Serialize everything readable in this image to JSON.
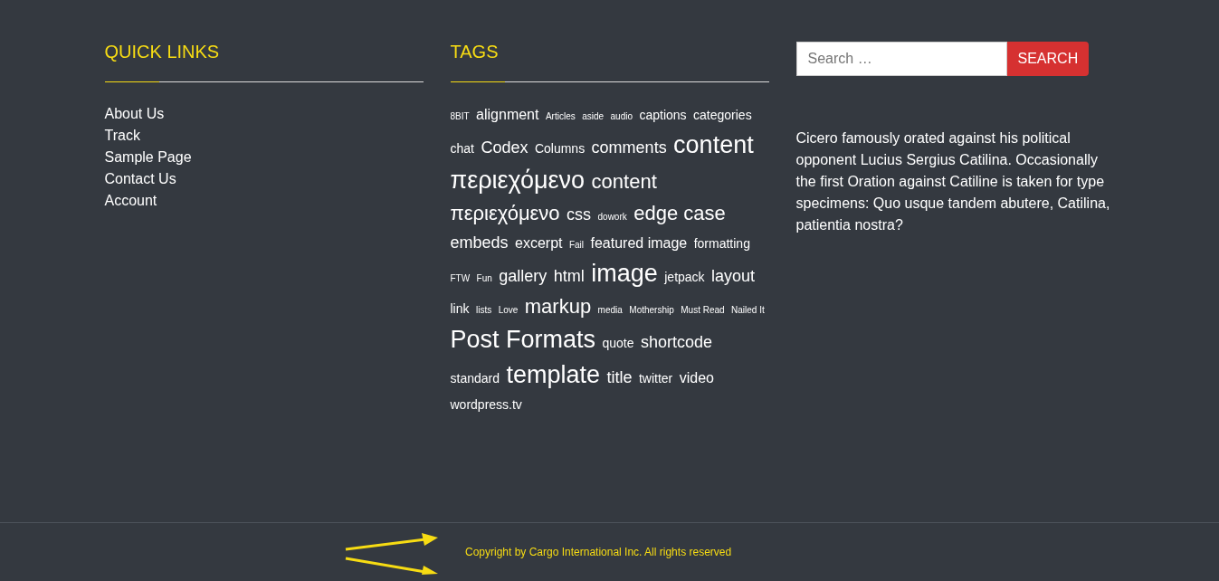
{
  "quick_links": {
    "title": "QUICK LINKS",
    "links": [
      "About Us",
      "Track",
      "Sample Page",
      "Contact Us",
      "Account"
    ]
  },
  "tags": {
    "title": "TAGS",
    "items": [
      {
        "label": "8BIT",
        "kind": "xs"
      },
      {
        "label": "alignment",
        "kind": "m"
      },
      {
        "label": "Articles",
        "kind": "xs"
      },
      {
        "label": "aside",
        "kind": "xs"
      },
      {
        "label": "audio",
        "kind": "xs"
      },
      {
        "label": "captions",
        "kind": "s"
      },
      {
        "label": "categories",
        "kind": "s"
      },
      {
        "label": "chat",
        "kind": "s"
      },
      {
        "label": "Codex",
        "kind": "l"
      },
      {
        "label": "Columns",
        "kind": "s"
      },
      {
        "label": "comments",
        "kind": "l"
      },
      {
        "label": "content",
        "kind": "xxl"
      },
      {
        "label": "περιεχόμενο",
        "kind": "xxl"
      },
      {
        "label": "content",
        "kind": "xl"
      },
      {
        "label": "περιεχόμενο",
        "kind": "xl"
      },
      {
        "label": "css",
        "kind": "l"
      },
      {
        "label": "dowork",
        "kind": "xs"
      },
      {
        "label": "edge case",
        "kind": "xl"
      },
      {
        "label": "embeds",
        "kind": "l"
      },
      {
        "label": "excerpt",
        "kind": "m"
      },
      {
        "label": "Fail",
        "kind": "xs"
      },
      {
        "label": "featured image",
        "kind": "m"
      },
      {
        "label": "formatting",
        "kind": "s"
      },
      {
        "label": "FTW",
        "kind": "xs"
      },
      {
        "label": "Fun",
        "kind": "xs"
      },
      {
        "label": "gallery",
        "kind": "l"
      },
      {
        "label": "html",
        "kind": "l"
      },
      {
        "label": "image",
        "kind": "xxl"
      },
      {
        "label": "jetpack",
        "kind": "s"
      },
      {
        "label": "layout",
        "kind": "l"
      },
      {
        "label": "link",
        "kind": "s"
      },
      {
        "label": "lists",
        "kind": "xs"
      },
      {
        "label": "Love",
        "kind": "xs"
      },
      {
        "label": "markup",
        "kind": "xl"
      },
      {
        "label": "media",
        "kind": "xs"
      },
      {
        "label": "Mothership",
        "kind": "xs"
      },
      {
        "label": "Must Read",
        "kind": "xs"
      },
      {
        "label": "Nailed It",
        "kind": "xs"
      },
      {
        "label": "Post Formats",
        "kind": "xxl"
      },
      {
        "label": "quote",
        "kind": "s"
      },
      {
        "label": "shortcode",
        "kind": "l"
      },
      {
        "label": "standard",
        "kind": "s"
      },
      {
        "label": "template",
        "kind": "xxl"
      },
      {
        "label": "title",
        "kind": "l"
      },
      {
        "label": "twitter",
        "kind": "s"
      },
      {
        "label": "video",
        "kind": "m"
      },
      {
        "label": "wordpress.tv",
        "kind": "s"
      }
    ]
  },
  "search": {
    "placeholder": "Search …",
    "button": "SEARCH"
  },
  "text": "Cicero famously orated against his political opponent Lucius Sergius Catilina. Occasionally the first Oration against Catiline is taken for type specimens: Quo usque tandem abutere, Catilina, patientia nostra?",
  "footer": {
    "copyright": "Copyright by Cargo International Inc. All rights reserved"
  }
}
